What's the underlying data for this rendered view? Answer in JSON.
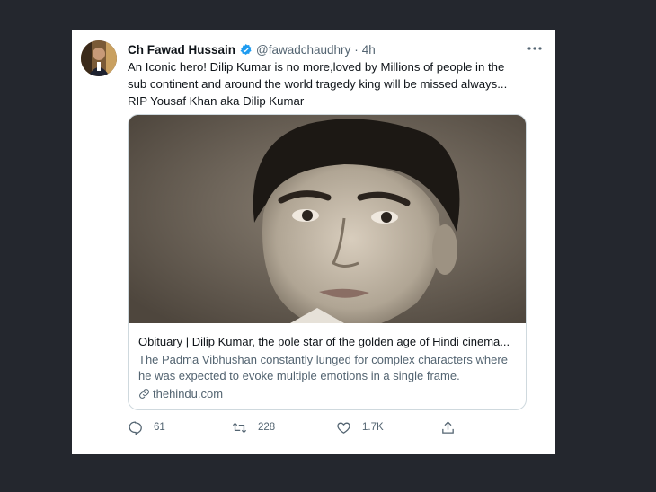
{
  "tweet": {
    "author_name": "Ch Fawad Hussain",
    "author_handle": "@fawadchaudhry",
    "separator": "·",
    "timestamp": "4h",
    "text": "An Iconic hero! Dilip Kumar is no more,loved by Millions of people in the sub continent and around the world tragedy king will be missed always... RIP Yousaf Khan aka Dilip Kumar",
    "verified_color": "#1d9bf0",
    "link_card": {
      "title": "Obituary | Dilip Kumar, the pole star of the golden age of Hindi cinema...",
      "description": "The Padma Vibhushan constantly lunged for complex characters where he was expected to evoke multiple emotions in a single frame.",
      "domain": "thehindu.com"
    },
    "actions": {
      "reply_count": "61",
      "retweet_count": "228",
      "like_count": "1.7K",
      "icons": [
        "reply-icon",
        "retweet-icon",
        "like-icon",
        "share-icon"
      ]
    }
  },
  "colors": {
    "page_background": "#24272e",
    "text_primary": "#0f1419",
    "text_secondary": "#536471"
  }
}
